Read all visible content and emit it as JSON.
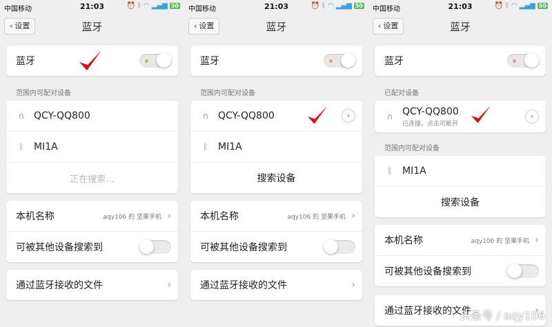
{
  "status": {
    "carrier": "中国移动",
    "time": "21:03",
    "battery": "50"
  },
  "nav": {
    "back_label": "设置",
    "title": "蓝牙"
  },
  "bluetooth_label": "蓝牙",
  "panels": [
    {
      "section_label": "范围内可配对设备",
      "devices": [
        "QCY-QQ800",
        "MI1A"
      ],
      "action": "正在搜索..."
    },
    {
      "section_label": "范围内可配对设备",
      "devices": [
        "QCY-QQ800",
        "MI1A"
      ],
      "action": "搜索设备"
    },
    {
      "paired_label": "已配对设备",
      "paired_device": "QCY-QQ800",
      "paired_status": "已连接，点击可断开",
      "section_label": "范围内可配对设备",
      "devices": [
        "MI1A"
      ],
      "action": "搜索设备"
    }
  ],
  "settings": {
    "device_name_label": "本机名称",
    "device_name_value": "aqy106 的 坚果手机",
    "discoverable_label": "可被其他设备搜索到",
    "receive_files_label": "通过蓝牙接收的文件"
  },
  "watermark": "头条号 / aqy106",
  "colors": {
    "check": "#e01010",
    "battery": "#5cb85c"
  }
}
